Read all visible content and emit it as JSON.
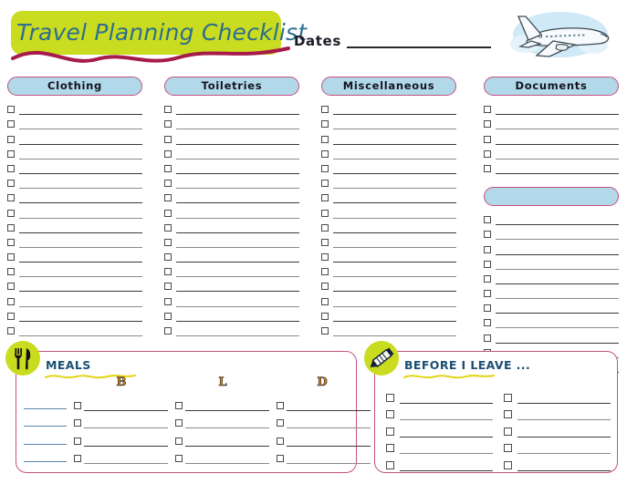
{
  "page": {
    "title": "Travel Planning Checklist",
    "background_color": "#ffffff",
    "banner_color": "#c9dc1f",
    "title_color": "#2e6e8e",
    "wave_color": "#a61b4a",
    "accent_pink": "#c2527f",
    "accent_blue": "#b2d9ea",
    "accent_green": "#c9dc1f"
  },
  "header": {
    "title": "Travel Planning Checklist",
    "dates_label": "Dates",
    "dates_value": "",
    "artwork": "airplane-illustration"
  },
  "columns": [
    {
      "id": "clothing",
      "header": "Clothing",
      "rows": 16,
      "extra_pill": null,
      "extra_rows": 0
    },
    {
      "id": "toiletries",
      "header": "Toiletries",
      "rows": 16,
      "extra_pill": null,
      "extra_rows": 0
    },
    {
      "id": "miscellaneous",
      "header": "Miscellaneous",
      "rows": 16,
      "extra_pill": null,
      "extra_rows": 0
    },
    {
      "id": "documents",
      "header": "Documents",
      "rows": 5,
      "extra_pill": "",
      "extra_rows": 11
    }
  ],
  "meals": {
    "title": "MEALS",
    "icon": "fork-and-knife-icon",
    "column_headers": [
      "B",
      "L",
      "D"
    ],
    "header_color": "#d2882c",
    "rows": 4,
    "date_line_color": "#5c87ab",
    "entries": [
      {
        "date": "",
        "B": "",
        "L": "",
        "D": ""
      },
      {
        "date": "",
        "B": "",
        "L": "",
        "D": ""
      },
      {
        "date": "",
        "B": "",
        "L": "",
        "D": ""
      },
      {
        "date": "",
        "B": "",
        "L": "",
        "D": ""
      }
    ]
  },
  "before_i_leave": {
    "title": "BEFORE I LEAVE ...",
    "icon": "pencil-icon",
    "rows": 5,
    "columns": 2,
    "entries": [
      {
        "left": "",
        "right": ""
      },
      {
        "left": "",
        "right": ""
      },
      {
        "left": "",
        "right": ""
      },
      {
        "left": "",
        "right": ""
      },
      {
        "left": "",
        "right": ""
      }
    ]
  }
}
